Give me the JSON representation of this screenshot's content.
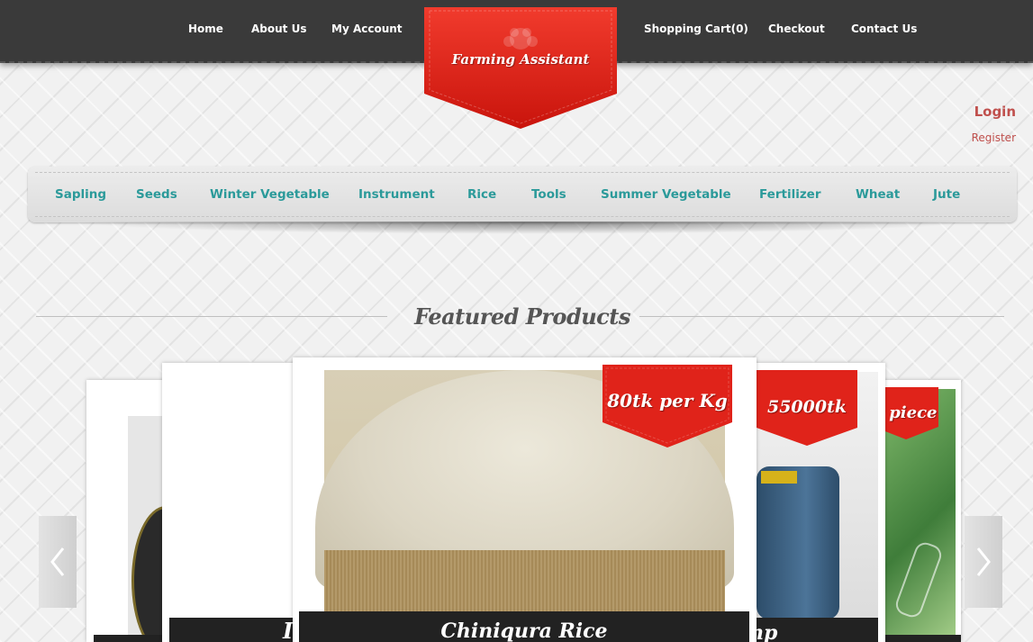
{
  "nav": {
    "left": [
      "Home",
      "About Us",
      "My Account"
    ],
    "right": [
      "Shopping Cart(0)",
      "Checkout",
      "Contact Us"
    ]
  },
  "logo": {
    "text": "Farming Assistant"
  },
  "auth": {
    "login": "Login",
    "register": "Register"
  },
  "categories": [
    "Sapling",
    "Seeds",
    "Winter Vegetable",
    "Instrument",
    "Rice",
    "Tools",
    "Summer Vegetable",
    "Fertilizer",
    "Wheat",
    "Jute"
  ],
  "featured": {
    "title": "Featured Products"
  },
  "carousel": {
    "prev_icon": "chevron-left-icon",
    "next_icon": "chevron-right-icon",
    "main": {
      "price": "80tk per Kg",
      "name": "Chiniqura Rice"
    },
    "right1": {
      "price": "55000tk",
      "name_partial": "np"
    },
    "right2": {
      "price_partial": "r piece"
    },
    "left1": {
      "name_partial": "I"
    }
  },
  "colors": {
    "topbar": "#3a3a3a",
    "ribbon": "#e0231a",
    "category_text": "#2b9a9a",
    "login": "#c0504d"
  }
}
